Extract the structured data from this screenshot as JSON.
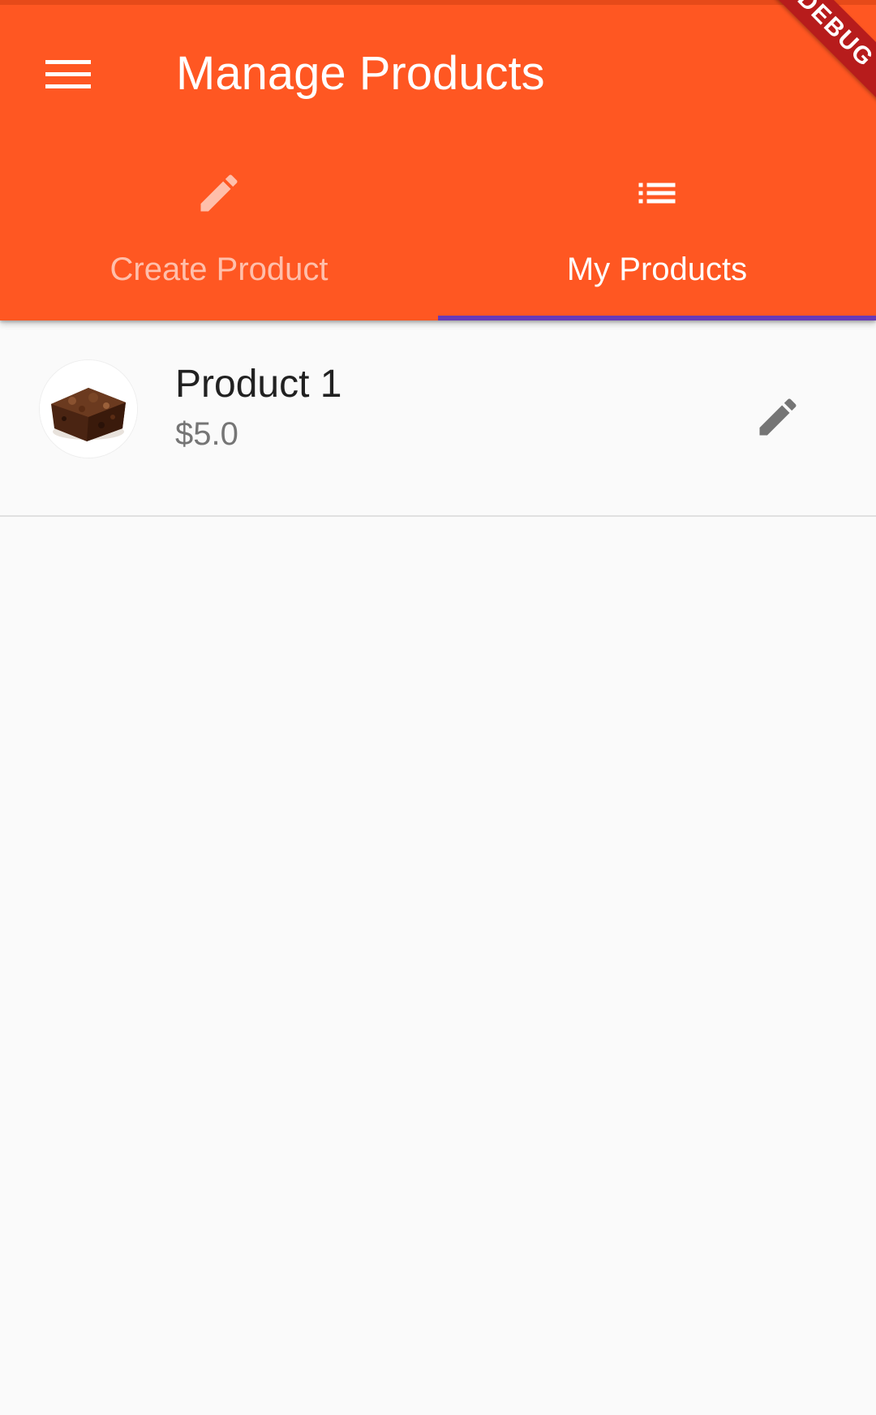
{
  "header": {
    "title": "Manage Products",
    "menu_icon": "menu-icon",
    "debug_banner": "DEBUG"
  },
  "tabs": [
    {
      "label": "Create Product",
      "icon": "edit-icon",
      "selected": false
    },
    {
      "label": "My Products",
      "icon": "list-icon",
      "selected": true
    }
  ],
  "products": [
    {
      "title": "Product 1",
      "price": "$5.0",
      "image": "brownie-thumbnail",
      "action_icon": "edit-icon"
    }
  ],
  "colors": {
    "primary": "#ff5722",
    "indicator": "#673ab7",
    "background": "#fafafa",
    "debug_ribbon": "#b71c1c"
  }
}
